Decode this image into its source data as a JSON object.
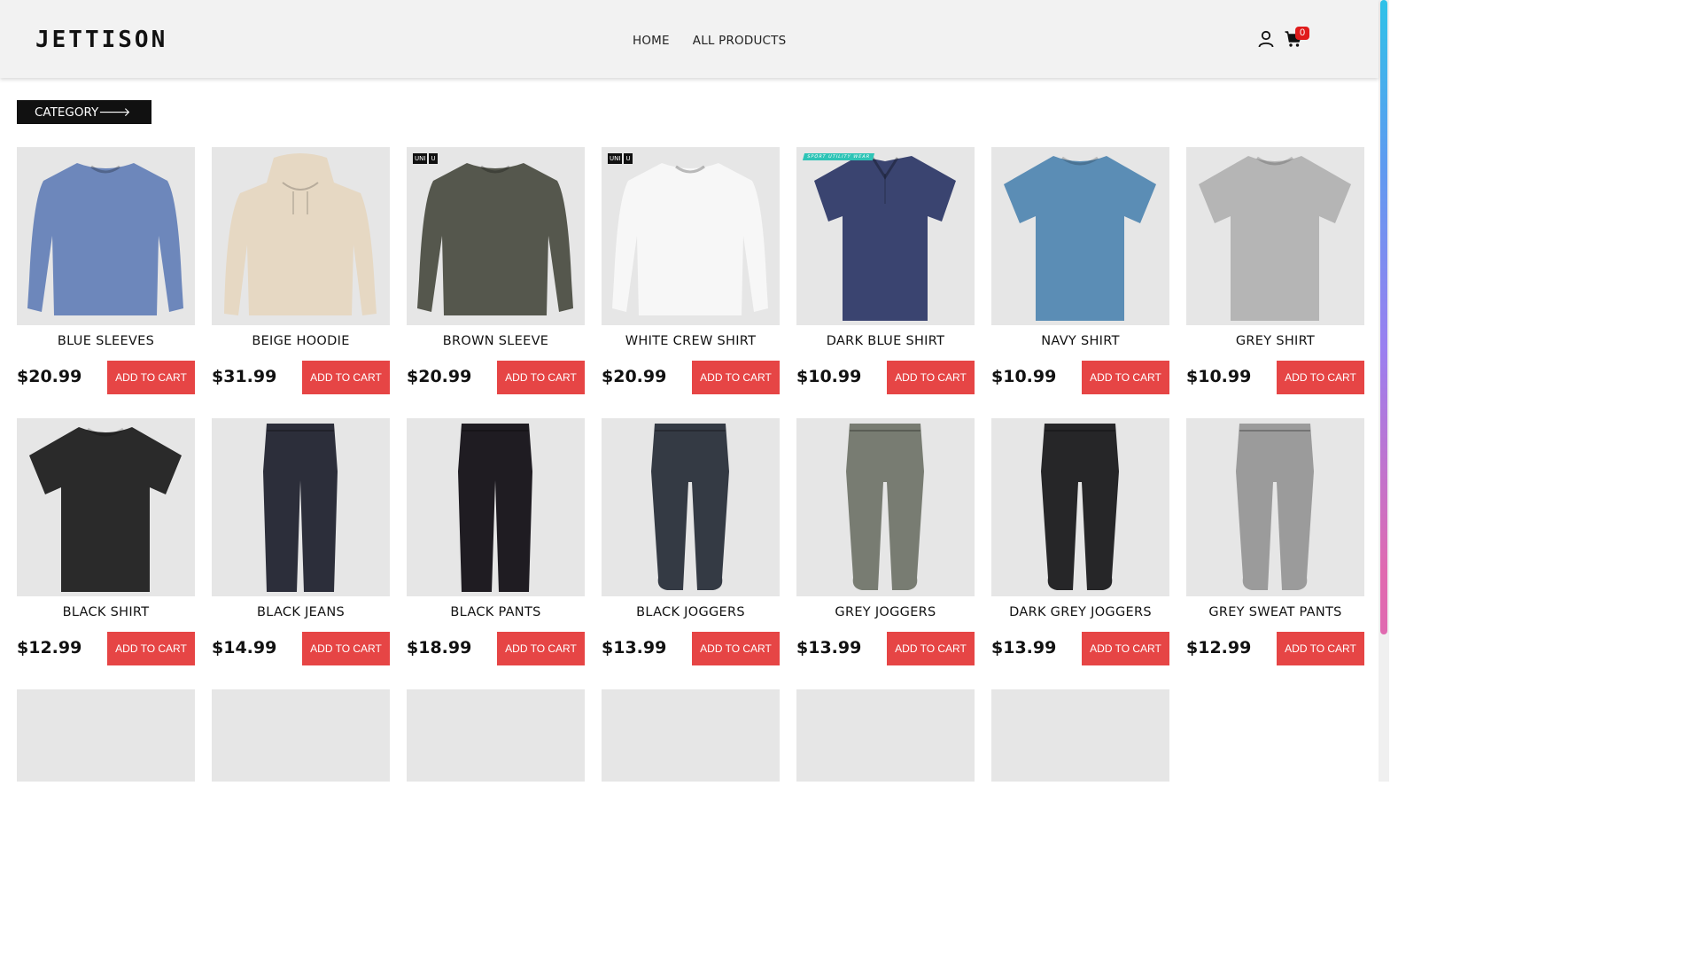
{
  "header": {
    "logo": "JETTISON",
    "nav": [
      {
        "label": "HOME"
      },
      {
        "label": "ALL PRODUCTS"
      }
    ],
    "cart_count": "0",
    "icons": [
      "user-icon",
      "cart-icon"
    ]
  },
  "category_button": "CATEGORY🡒",
  "colors": {
    "header_bg": "#f2f2f2",
    "button_red": "#e64545",
    "badge_red": "#e01b1b",
    "tile_bg": "#e6e6e6"
  },
  "products": [
    {
      "name": "BLUE SLEEVES",
      "price": "$20.99",
      "cta": "ADD TO CART",
      "color": "#6d87bb"
    },
    {
      "name": "BEIGE HOODIE",
      "price": "$31.99",
      "cta": "ADD TO CART",
      "color": "#e6d8c3"
    },
    {
      "name": "BROWN SLEEVE",
      "price": "$20.99",
      "cta": "ADD TO CART",
      "color": "#55574d"
    },
    {
      "name": "WHITE CREW SHIRT",
      "price": "$20.99",
      "cta": "ADD TO CART",
      "color": "#f7f7f7"
    },
    {
      "name": "DARK BLUE SHIRT",
      "price": "$10.99",
      "cta": "ADD TO CART",
      "color": "#3a4470"
    },
    {
      "name": "NAVY SHIRT",
      "price": "$10.99",
      "cta": "ADD TO CART",
      "color": "#5b8db5"
    },
    {
      "name": "GREY SHIRT",
      "price": "$10.99",
      "cta": "ADD TO CART",
      "color": "#b5b5b5"
    },
    {
      "name": "BLACK SHIRT",
      "price": "$12.99",
      "cta": "ADD TO CART",
      "color": "#2a2a2a"
    },
    {
      "name": "BLACK JEANS",
      "price": "$14.99",
      "cta": "ADD TO CART",
      "color": "#2c2e3a"
    },
    {
      "name": "BLACK PANTS",
      "price": "$18.99",
      "cta": "ADD TO CART",
      "color": "#1f1c22"
    },
    {
      "name": "BLACK JOGGERS",
      "price": "$13.99",
      "cta": "ADD TO CART",
      "color": "#343a44"
    },
    {
      "name": "GREY JOGGERS",
      "price": "$13.99",
      "cta": "ADD TO CART",
      "color": "#787c72"
    },
    {
      "name": "DARK GREY JOGGERS",
      "price": "$13.99",
      "cta": "ADD TO CART",
      "color": "#262628"
    },
    {
      "name": "GREY SWEAT PANTS",
      "price": "$12.99",
      "cta": "ADD TO CART",
      "color": "#9b9b9b"
    },
    {
      "name": "",
      "price": "",
      "cta": "",
      "color": "#141414"
    },
    {
      "name": "",
      "price": "",
      "cta": "",
      "color": "#2b221c"
    },
    {
      "name": "",
      "price": "",
      "cta": "",
      "color": "#2c3447"
    },
    {
      "name": "",
      "price": "",
      "cta": "",
      "color": "#4a4a36"
    },
    {
      "name": "",
      "price": "",
      "cta": "",
      "color": "#1c2648"
    },
    {
      "name": "",
      "price": "",
      "cta": "",
      "color": "#1a2a1c"
    }
  ]
}
